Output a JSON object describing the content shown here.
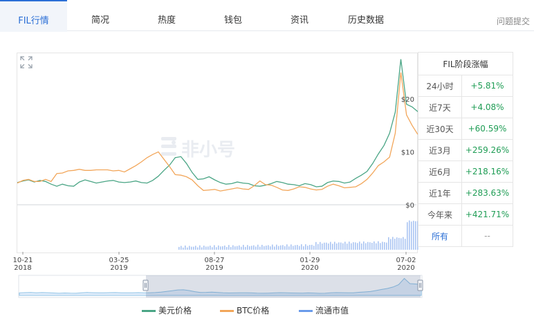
{
  "tabs": [
    "FIL行情",
    "简况",
    "热度",
    "钱包",
    "资讯",
    "历史数据"
  ],
  "help_label": "问题提交",
  "watermark": "非小号",
  "stats": {
    "title": "FIL阶段涨幅",
    "rows": [
      {
        "label": "24小时",
        "value": "+5.81%"
      },
      {
        "label": "近7天",
        "value": "+4.08%"
      },
      {
        "label": "近30天",
        "value": "+60.59%"
      },
      {
        "label": "近3月",
        "value": "+259.26%"
      },
      {
        "label": "近6月",
        "value": "+218.16%"
      },
      {
        "label": "近1年",
        "value": "+283.63%"
      },
      {
        "label": "今年来",
        "value": "+421.71%"
      }
    ],
    "all_label": "所有",
    "all_value": "--"
  },
  "chart_data": {
    "type": "line",
    "x_tick_labels": [
      {
        "date": "10-21",
        "year": "2018"
      },
      {
        "date": "03-25",
        "year": "2019"
      },
      {
        "date": "08-27",
        "year": "2019"
      },
      {
        "date": "01-29",
        "year": "2020"
      },
      {
        "date": "07-02",
        "year": "2020"
      }
    ],
    "y_tick_labels": [
      "$20",
      "$10",
      "$0"
    ],
    "ylim": [
      0,
      20
    ],
    "legend": [
      {
        "name": "美元价格",
        "color": "#4aa585"
      },
      {
        "name": "BTC价格",
        "color": "#f2a65a"
      },
      {
        "name": "流通市值",
        "color": "#6a9bea"
      }
    ],
    "series": [
      {
        "name": "美元价格",
        "values": [
          4.2,
          4.5,
          4.7,
          4.3,
          4.6,
          4.4,
          3.9,
          3.5,
          3.9,
          3.6,
          3.5,
          4.3,
          4.7,
          4.4,
          4.1,
          4.3,
          4.5,
          4.6,
          4.3,
          4.2,
          4.3,
          4.5,
          4.2,
          4.1,
          4.6,
          5.4,
          6.5,
          7.5,
          8.9,
          9.1,
          7.8,
          6.1,
          4.8,
          4.9,
          5.3,
          4.7,
          4.2,
          3.9,
          4.0,
          4.3,
          4.1,
          4.0,
          3.6,
          3.5,
          3.7,
          4.0,
          4.4,
          4.2,
          3.9,
          3.8,
          3.6,
          4.0,
          3.8,
          3.4,
          3.5,
          4.2,
          4.5,
          4.4,
          4.1,
          4.3,
          5.0,
          5.6,
          6.3,
          7.8,
          9.6,
          11.2,
          13.5,
          17.5,
          27.5,
          19.0,
          18.5,
          17.6
        ]
      },
      {
        "name": "BTC价格",
        "values": [
          4.1,
          4.6,
          4.8,
          4.4,
          4.4,
          4.8,
          4.4,
          5.9,
          6.0,
          6.4,
          6.5,
          6.7,
          6.5,
          6.5,
          6.6,
          6.6,
          6.6,
          6.4,
          6.5,
          6.2,
          6.8,
          7.4,
          8.1,
          8.9,
          9.5,
          10.0,
          8.6,
          7.2,
          5.7,
          5.6,
          5.3,
          4.7,
          3.6,
          2.7,
          2.8,
          2.9,
          2.6,
          2.8,
          3.0,
          3.2,
          3.0,
          2.9,
          3.6,
          4.5,
          3.8,
          3.7,
          3.3,
          2.8,
          2.7,
          3.0,
          3.4,
          3.3,
          3.0,
          2.8,
          2.9,
          3.5,
          3.9,
          3.6,
          3.2,
          3.3,
          3.4,
          4.0,
          4.8,
          6.0,
          7.4,
          8.1,
          9.0,
          13.5,
          25.0,
          17.0,
          15.0,
          13.3
        ]
      }
    ]
  }
}
